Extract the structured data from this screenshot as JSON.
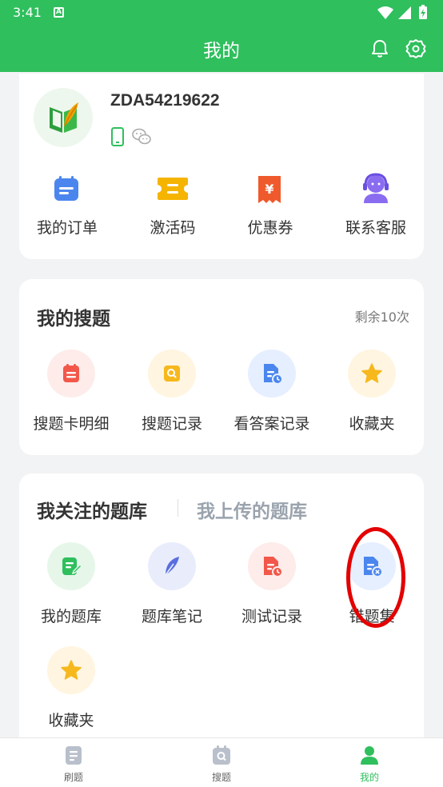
{
  "status_bar": {
    "time": "3:41",
    "badge": "A"
  },
  "header": {
    "title": "我的"
  },
  "profile": {
    "username": "ZDA54219622",
    "quick_actions": [
      {
        "label": "我的订单",
        "icon": "order-icon"
      },
      {
        "label": "激活码",
        "icon": "ticket-icon"
      },
      {
        "label": "优惠券",
        "icon": "coupon-icon"
      },
      {
        "label": "联系客服",
        "icon": "customer-service-icon"
      }
    ]
  },
  "search": {
    "title": "我的搜题",
    "remaining": "剩余10次",
    "items": [
      {
        "label": "搜题卡明细",
        "icon": "search-card-icon"
      },
      {
        "label": "搜题记录",
        "icon": "search-record-icon"
      },
      {
        "label": "看答案记录",
        "icon": "answer-record-icon"
      },
      {
        "label": "收藏夹",
        "icon": "star-icon"
      }
    ]
  },
  "library": {
    "tab_followed": "我关注的题库",
    "tab_uploaded": "我上传的题库",
    "items": [
      {
        "label": "我的题库",
        "icon": "my-bank-icon"
      },
      {
        "label": "题库笔记",
        "icon": "feather-note-icon"
      },
      {
        "label": "测试记录",
        "icon": "test-record-icon"
      },
      {
        "label": "错题集",
        "icon": "wrong-questions-icon"
      },
      {
        "label": "收藏夹",
        "icon": "star-icon"
      }
    ]
  },
  "bottom_nav": [
    {
      "label": "刷题",
      "icon": "practice-icon"
    },
    {
      "label": "搜题",
      "icon": "search-tab-icon"
    },
    {
      "label": "我的",
      "icon": "profile-tab-icon"
    }
  ],
  "colors": {
    "brand_green": "#2fbf5d",
    "annotation_red": "#e30000"
  }
}
